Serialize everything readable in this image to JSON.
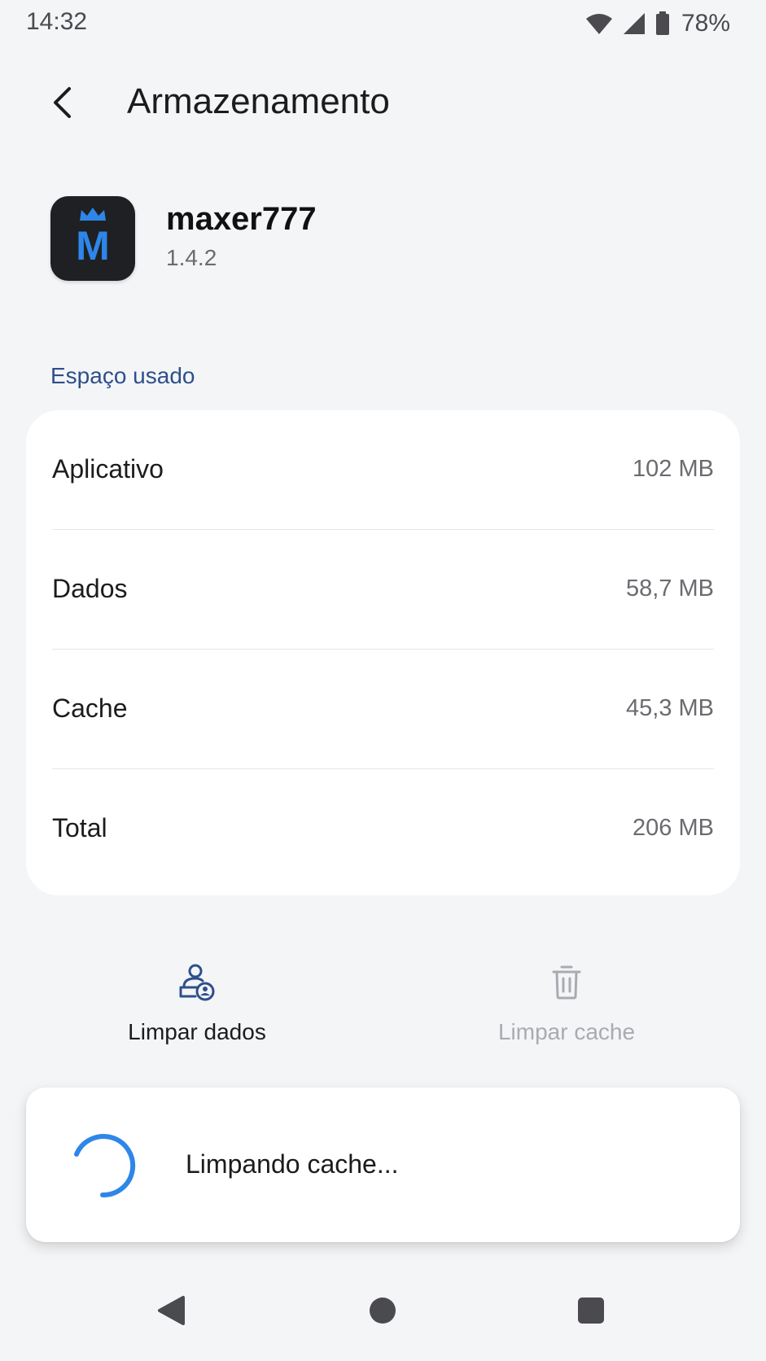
{
  "status_bar": {
    "time": "14:32",
    "battery": "78%",
    "icons": [
      "wifi-icon",
      "signal-icon",
      "battery-icon"
    ]
  },
  "header": {
    "title": "Armazenamento",
    "back_icon": "chevron-left-icon"
  },
  "app": {
    "name": "maxer777",
    "version": "1.4.2",
    "icon_letter": "M",
    "icon_colors": {
      "background": "#1f2023",
      "letter": "#2e86e8"
    }
  },
  "storage": {
    "section_label": "Espaço usado",
    "rows": [
      {
        "label": "Aplicativo",
        "value": "102 MB"
      },
      {
        "label": "Dados",
        "value": "58,7 MB"
      },
      {
        "label": "Cache",
        "value": "45,3 MB"
      },
      {
        "label": "Total",
        "value": "206 MB"
      }
    ]
  },
  "actions": {
    "clear_data": {
      "label": "Limpar dados",
      "icon": "clear-data-icon",
      "enabled": true
    },
    "clear_cache": {
      "label": "Limpar cache",
      "icon": "trash-icon",
      "enabled": false
    }
  },
  "progress": {
    "text": "Limpando cache...",
    "spinner_color": "#2e86e8"
  },
  "colors": {
    "background": "#f4f5f7",
    "card": "#ffffff",
    "accent": "#2e4f8a",
    "disabled": "#a9abb0"
  },
  "nav_bar": {
    "buttons": [
      "back-triangle-icon",
      "home-circle-icon",
      "recents-square-icon"
    ]
  }
}
